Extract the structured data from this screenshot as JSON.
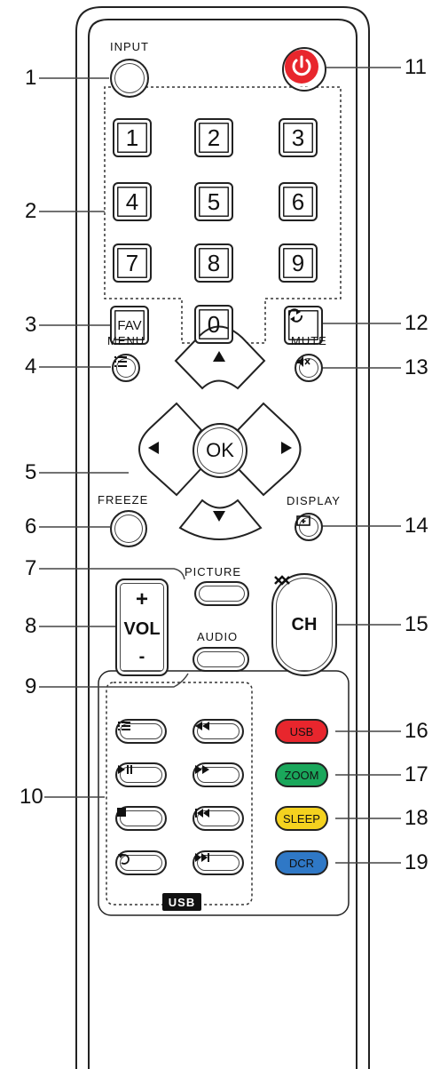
{
  "labels": {
    "input": "INPUT",
    "menu": "MENU",
    "mute": "MUTE",
    "freeze": "FREEZE",
    "display": "DISPLAY",
    "picture": "PICTURE",
    "audio": "AUDIO",
    "vol": "VOL",
    "vol_plus": "+",
    "vol_minus": "-",
    "ch": "CH",
    "ok": "OK",
    "fav": "FAV",
    "usb_tag": "USB"
  },
  "digits": [
    "1",
    "2",
    "3",
    "4",
    "5",
    "6",
    "7",
    "8",
    "9",
    "0"
  ],
  "color_keys": {
    "usb": "USB",
    "zoom": "ZOOM",
    "sleep": "SLEEP",
    "dcr": "DCR"
  },
  "colors": {
    "power": "#e8262d",
    "usb": "#e8262d",
    "zoom": "#1aa75b",
    "sleep": "#f4d21f",
    "dcr": "#2f78c6"
  },
  "callouts_left": [
    "1",
    "2",
    "3",
    "4",
    "5",
    "6",
    "7",
    "8",
    "9",
    "10"
  ],
  "callouts_right": [
    "11",
    "12",
    "13",
    "14",
    "15",
    "16",
    "17",
    "18",
    "19"
  ],
  "icons": {
    "power": "power-icon",
    "swap": "swap-icon",
    "menu": "list-icon",
    "mute": "mute-icon",
    "display": "display-icon",
    "up": "arrow-up-icon",
    "down": "arrow-down-icon",
    "left": "arrow-left-icon",
    "right": "arrow-right-icon",
    "usb_list": "list-icon",
    "rewind": "rewind-icon",
    "play_pause": "play-pause-icon",
    "fast_forward": "fast-forward-icon",
    "stop": "stop-icon",
    "previous": "skip-previous-icon",
    "return": "return-icon",
    "next": "skip-next-icon"
  }
}
